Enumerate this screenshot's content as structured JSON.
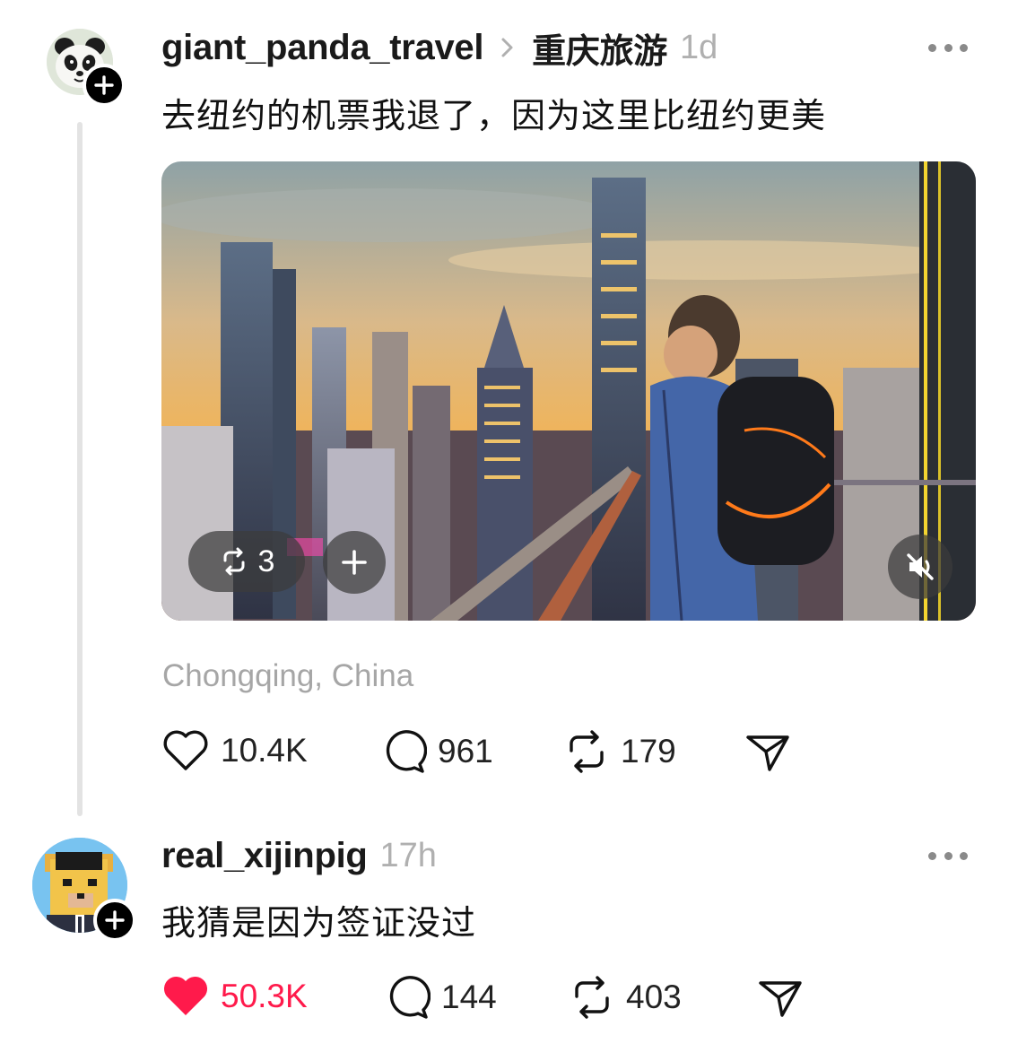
{
  "post": {
    "username": "giant_panda_travel",
    "community": "重庆旅游",
    "time": "1d",
    "text": "去纽约的机票我退了，因为这里比纽约更美",
    "media_repost_count": "3",
    "location": "Chongqing, China",
    "likes": "10.4K",
    "replies": "961",
    "reposts": "179",
    "liked": false,
    "avatar_icon": "panda-avatar-icon",
    "media_description_icon": "city-sunset-video"
  },
  "reply": {
    "username": "real_xijinpig",
    "time": "17h",
    "text": "我猜是因为签证没过",
    "likes": "50.3K",
    "replies": "144",
    "reposts": "403",
    "liked": true,
    "avatar_icon": "pixel-bear-avatar-icon"
  },
  "colors": {
    "like_active": "#ff1a4b",
    "muted_text": "#a8a8a8",
    "thread_line": "#e3e3e3"
  }
}
